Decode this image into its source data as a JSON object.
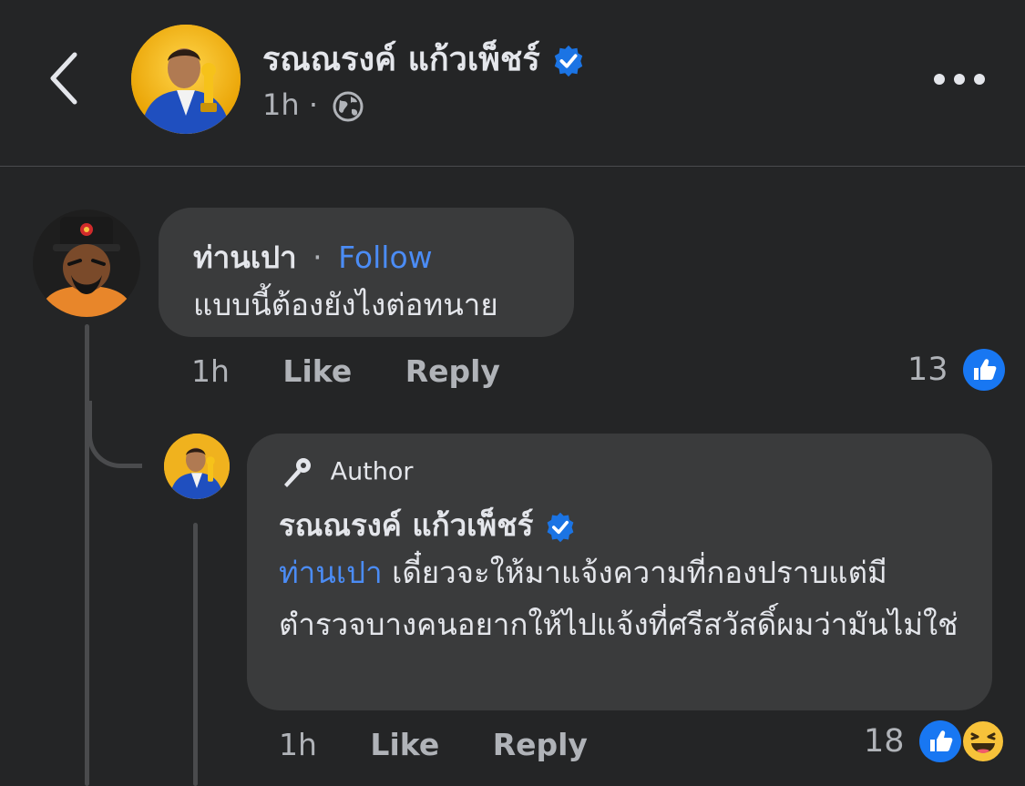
{
  "header": {
    "name": "รณณรงค์ แก้วเพ็ชร์",
    "time": "1h",
    "separator": "·",
    "privacy_icon": "globe-icon",
    "back_icon": "chevron-left-icon",
    "more_icon": "more-horizontal-icon"
  },
  "comment": {
    "author": "ท่านเปา",
    "dot": "·",
    "follow_label": "Follow",
    "text": "แบบนี้ต้องยังไงต่อทนาย",
    "time": "1h",
    "like_label": "Like",
    "reply_label": "Reply",
    "reaction_count": "13",
    "reactions": [
      "like-icon"
    ]
  },
  "reply": {
    "author_badge": "Author",
    "author": "รณณรงค์ แก้วเพ็ชร์",
    "mention": "ท่านเปา",
    "text": " เดี๋ยวจะให้มาแจ้งความที่กองปราบแต่มีตำรวจบางคนอยากให้ไปแจ้งที่ศรีสวัสดิ์ผมว่ามันไม่ใช่",
    "time": "1h",
    "like_label": "Like",
    "reply_label": "Reply",
    "reaction_count": "18",
    "reactions": [
      "like-icon",
      "haha-icon"
    ]
  },
  "colors": {
    "background": "#242526",
    "bubble": "#3a3b3c",
    "link": "#4b8cf5",
    "verified": "#1b74e4",
    "like": "#1877f2"
  }
}
